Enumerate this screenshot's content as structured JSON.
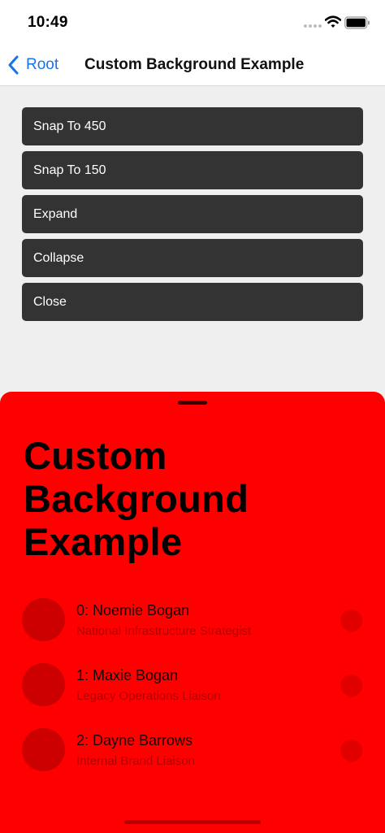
{
  "status_bar": {
    "time": "10:49"
  },
  "nav": {
    "back_label": "Root",
    "title": "Custom Background Example"
  },
  "buttons": [
    {
      "label": "Snap To 450"
    },
    {
      "label": "Snap To 150"
    },
    {
      "label": "Expand"
    },
    {
      "label": "Collapse"
    },
    {
      "label": "Close"
    }
  ],
  "sheet": {
    "background_color": "#ff0000",
    "title": "Custom Background Example",
    "items": [
      {
        "name": "0: Noemie Bogan",
        "subtitle": "National Infrastructure Strategist"
      },
      {
        "name": "1: Maxie Bogan",
        "subtitle": "Legacy Operations Liaison"
      },
      {
        "name": "2: Dayne Barrows",
        "subtitle": "Internal Brand Liaison"
      }
    ]
  },
  "colors": {
    "accent": "#1a73e8",
    "button_background": "#333333",
    "page_background": "#efefef"
  },
  "icons": {
    "back": "chevron-left-icon",
    "signal": "cellular-signal-icon",
    "wifi": "wifi-icon",
    "battery": "battery-icon"
  }
}
